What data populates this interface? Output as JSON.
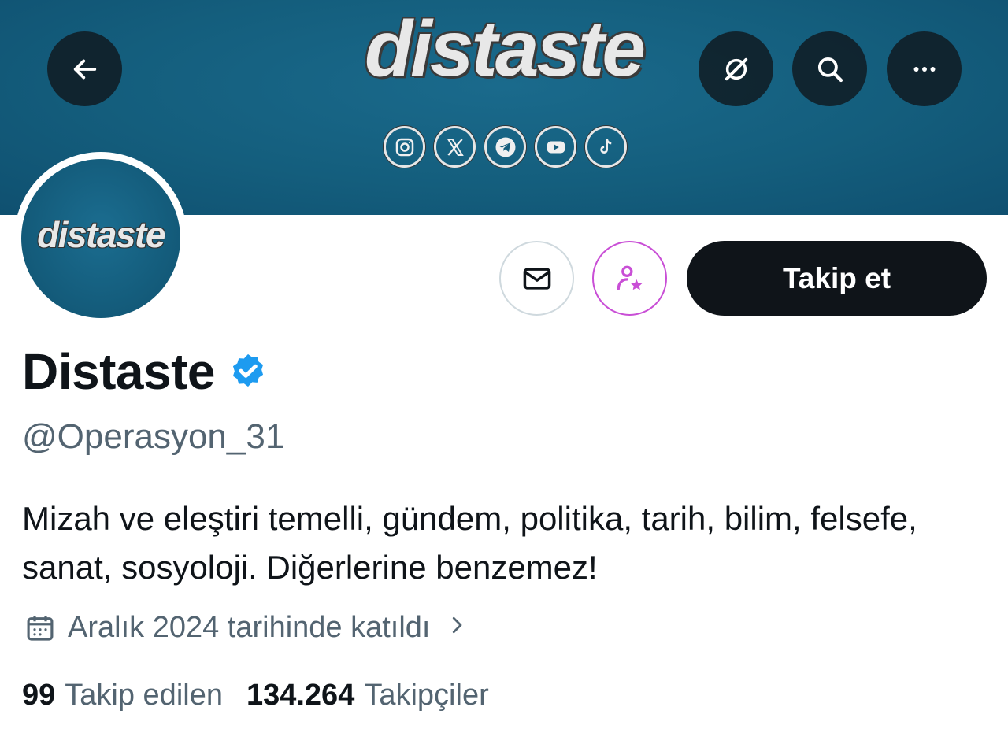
{
  "banner": {
    "title": "distaste",
    "social_icons": [
      "instagram-icon",
      "x-icon",
      "telegram-icon",
      "youtube-icon",
      "tiktok-icon"
    ]
  },
  "top_bar": {
    "back_icon": "arrow-left-icon",
    "grok_icon": "grok-icon",
    "search_icon": "search-icon",
    "more_icon": "more-horizontal-icon"
  },
  "avatar": {
    "text": "distaste"
  },
  "actions": {
    "message_icon": "mail-icon",
    "subscribe_icon": "subscribe-star-icon",
    "follow_label": "Takip et"
  },
  "profile": {
    "name": "Distaste",
    "verified": true,
    "handle": "@Operasyon_31",
    "bio": "Mizah ve eleştiri temelli, gündem, politika, tarih, bilim, felsefe, sanat, sosyoloji. Diğerlerine benzemez!",
    "joined": "Aralık 2024 tarihinde katıldı"
  },
  "stats": {
    "following_count": "99",
    "following_label": "Takip edilen",
    "followers_count": "134.264",
    "followers_label": "Takipçiler"
  },
  "colors": {
    "banner": "#145e7d",
    "verified": "#1d9bf0",
    "subscribe_accent": "#c94fd6",
    "secondary_text": "#536471"
  }
}
